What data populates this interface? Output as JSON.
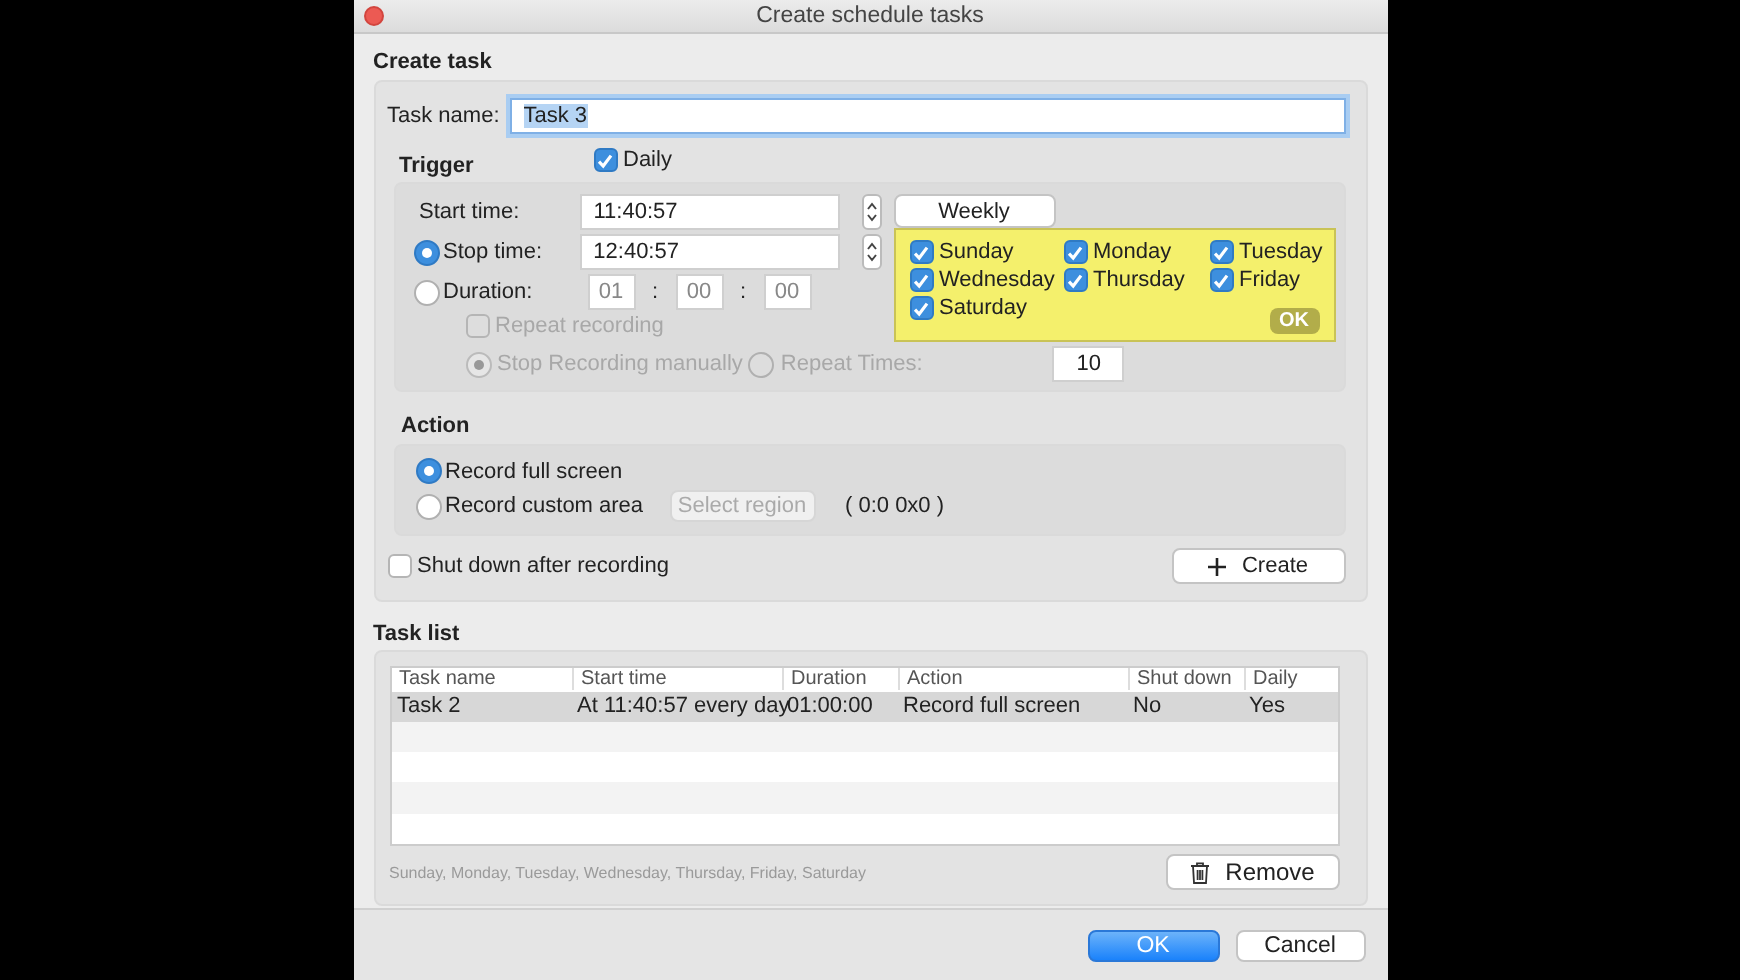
{
  "window": {
    "title": "Create schedule tasks"
  },
  "create_task": {
    "title": "Create task",
    "task_name": {
      "label": "Task name:",
      "value": "Task 3"
    },
    "trigger": {
      "title": "Trigger",
      "daily": {
        "label": "Daily",
        "checked": true
      },
      "start_time": {
        "label": "Start time:",
        "value": "11:40:57"
      },
      "stop_time": {
        "label": "Stop time:",
        "value": "12:40:57",
        "selected": true
      },
      "duration": {
        "label": "Duration:",
        "selected": false,
        "values": [
          "01",
          "00",
          "00"
        ],
        "separator": ":"
      },
      "repeat_recording": {
        "label": "Repeat recording",
        "checked": false,
        "disabled": true
      },
      "stop_manually": {
        "label": "Stop Recording manually",
        "selected": true,
        "disabled": true
      },
      "repeat_times": {
        "label": "Repeat Times:",
        "selected": false,
        "disabled": true,
        "value": "10"
      },
      "weekly": {
        "label": "Weekly",
        "ok": "OK",
        "days": [
          {
            "label": "Sunday",
            "checked": true
          },
          {
            "label": "Monday",
            "checked": true
          },
          {
            "label": "Tuesday",
            "checked": true
          },
          {
            "label": "Wednesday",
            "checked": true
          },
          {
            "label": "Thursday",
            "checked": true
          },
          {
            "label": "Friday",
            "checked": true
          },
          {
            "label": "Saturday",
            "checked": true
          }
        ]
      }
    },
    "action": {
      "title": "Action",
      "options": [
        {
          "label": "Record full screen",
          "selected": true
        },
        {
          "label": "Record custom area",
          "selected": false
        }
      ],
      "select_region": "Select region",
      "region": "( 0:0 0x0 )"
    },
    "shutdown": {
      "label": "Shut down after recording",
      "checked": false
    },
    "create": "Create"
  },
  "task_list": {
    "title": "Task list",
    "columns": [
      "Task name",
      "Start time",
      "Duration",
      "Action",
      "Shut down",
      "Daily"
    ],
    "rows": [
      {
        "cells": [
          "Task 2",
          "At 11:40:57 every day",
          "01:00:00",
          "Record full screen",
          "No",
          "Yes"
        ],
        "selected": true
      }
    ],
    "days_summary": "Sunday,  Monday,  Tuesday,  Wednesday,  Thursday,  Friday,  Saturday",
    "remove": "Remove"
  },
  "buttons": [
    {
      "label": "OK",
      "kind": "primary"
    },
    {
      "label": "Cancel",
      "kind": "default"
    }
  ]
}
